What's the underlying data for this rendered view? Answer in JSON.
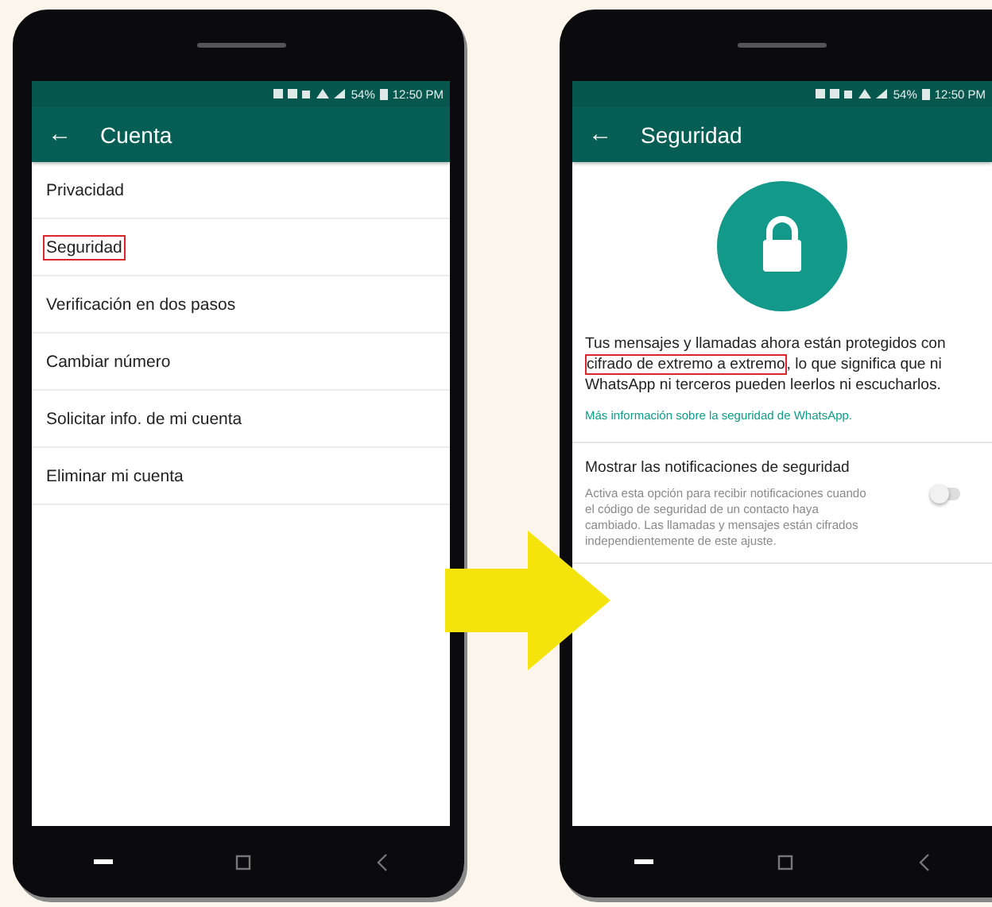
{
  "phones": [
    {
      "status_bar": {
        "battery": "54%",
        "time": "12:50 PM"
      },
      "toolbar": {
        "back": "←",
        "title": "Cuenta"
      },
      "kind": "menu",
      "items": [
        {
          "label": "Privacidad",
          "highlighted": false
        },
        {
          "label": "Seguridad",
          "highlighted": true
        },
        {
          "label": "Verificación en dos pasos",
          "highlighted": false
        },
        {
          "label": "Cambiar número",
          "highlighted": false
        },
        {
          "label": "Solicitar info. de mi cuenta",
          "highlighted": false
        },
        {
          "label": "Eliminar mi cuenta",
          "highlighted": false
        }
      ]
    },
    {
      "status_bar": {
        "battery": "54%",
        "time": "12:50 PM"
      },
      "toolbar": {
        "back": "←",
        "title": "Seguridad"
      },
      "kind": "security",
      "paragraph": {
        "before": "Tus mensajes y llamadas ahora están protegidos con ",
        "highlight": "cifrado de extremo a extremo",
        "after": ", lo que significa que ni WhatsApp ni terceros pueden leerlos ni escucharlos."
      },
      "link": "Más información sobre la seguridad de WhatsApp.",
      "setting": {
        "title": "Mostrar las notificaciones de seguridad",
        "description": "Activa esta opción para recibir notificaciones cuando el código de seguridad de un contacto haya cambiado. Las llamadas y mensajes están cifrados independientemente de este ajuste.",
        "on": false
      }
    }
  ]
}
